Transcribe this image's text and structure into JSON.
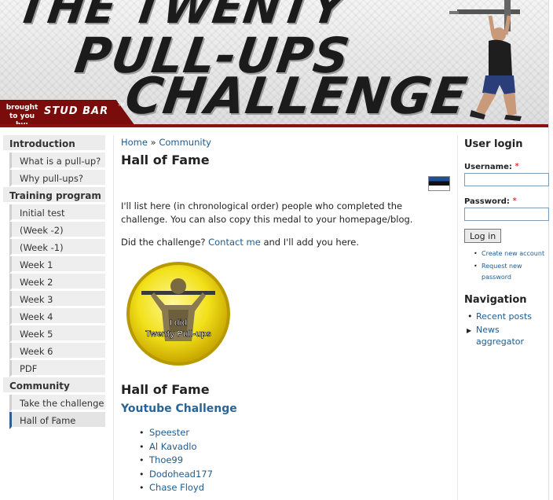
{
  "banner": {
    "title_line1": "THE TWENTY",
    "title_line2": "PULL-UPS",
    "title_line3": "CHALLENGE",
    "brought_by": "brought to you by:",
    "sponsor": "STUD BAR",
    "tm": "TM"
  },
  "sidebar": {
    "sections": [
      {
        "label": "Introduction",
        "items": [
          "What is a pull-up?",
          "Why pull-ups?"
        ]
      },
      {
        "label": "Training program",
        "items": [
          "Initial test",
          "(Week -2)",
          "(Week -1)",
          "Week 1",
          "Week 2",
          "Week 3",
          "Week 4",
          "Week 5",
          "Week 6",
          "PDF"
        ]
      },
      {
        "label": "Community",
        "items": [
          "Take the challenge",
          "Hall of Fame"
        ]
      }
    ],
    "active_item": "Hall of Fame"
  },
  "main": {
    "breadcrumb_home": "Home",
    "breadcrumb_sep": "»",
    "breadcrumb_community": "Community",
    "title": "Hall of Fame",
    "paragraph1": "I'll list here (in chronological order) people who completed the challenge. You can also copy this medal to your homepage/blog.",
    "paragraph2_before": "Did the challenge?",
    "paragraph2_link": "Contact me",
    "paragraph2_after": "and I'll add you here.",
    "medal_text_line1": "I did",
    "medal_text_line2": "Twenty Pull-ups",
    "hall_heading": "Hall of Fame",
    "youtube_heading": "Youtube Challenge",
    "names": [
      "Speester",
      "Al Kavadlo",
      "Thoe99",
      "Dodohead177",
      "Chase Floyd"
    ]
  },
  "login": {
    "heading": "User login",
    "username_label": "Username:",
    "password_label": "Password:",
    "required_mark": "*",
    "username_value": "",
    "password_value": "",
    "login_button": "Log in",
    "create_account": "Create new account",
    "request_password": "Request new password"
  },
  "navigation": {
    "heading": "Navigation",
    "items": [
      "Recent posts",
      "News aggregator"
    ]
  },
  "colors": {
    "link": "#1f5b8e",
    "banner_red": "#8b1111",
    "active_border": "#2f5f8e"
  }
}
